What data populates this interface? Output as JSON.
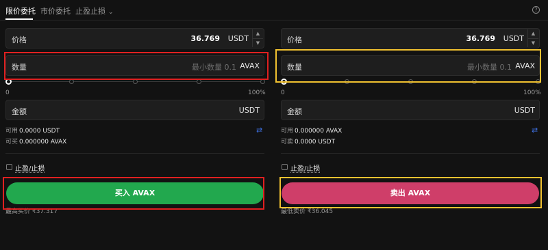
{
  "tabs": {
    "limit": "限价委托",
    "market": "市价委托",
    "tpsl": "止盈止损",
    "tpsl_chevron": "chevron-down-icon",
    "help": "?"
  },
  "buy": {
    "price_label": "价格",
    "price_value": "36.769",
    "price_unit": "USDT",
    "qty_label": "数量",
    "qty_placeholder": "最小数量 0.1",
    "qty_unit": "AVAX",
    "slider_min": "0",
    "slider_max": "100%",
    "amount_label": "金额",
    "amount_unit": "USDT",
    "available_label": "可用",
    "available_value": "0.0000 USDT",
    "can_buy_label": "可买",
    "can_buy_value": "0.000000 AVAX",
    "tpsl_label": "止盈/止损",
    "button": "买入 AVAX",
    "best_price": "最高买价 ₹37.317"
  },
  "sell": {
    "price_label": "价格",
    "price_value": "36.769",
    "price_unit": "USDT",
    "qty_label": "数量",
    "qty_placeholder": "最小数量 0.1",
    "qty_unit": "AVAX",
    "slider_min": "0",
    "slider_max": "100%",
    "amount_label": "金额",
    "amount_unit": "USDT",
    "available_label": "可用",
    "available_value": "0.000000 AVAX",
    "can_sell_label": "可卖",
    "can_sell_value": "0.0000 USDT",
    "tpsl_label": "止盈/止损",
    "button": "卖出 AVAX",
    "best_price": "最低卖价 ₹36.045"
  },
  "colors": {
    "buy": "#22a84e",
    "sell": "#cf3e69",
    "highlight_buy": "#e02020",
    "highlight_sell": "#f2c230",
    "accent": "#3d6fe0"
  }
}
